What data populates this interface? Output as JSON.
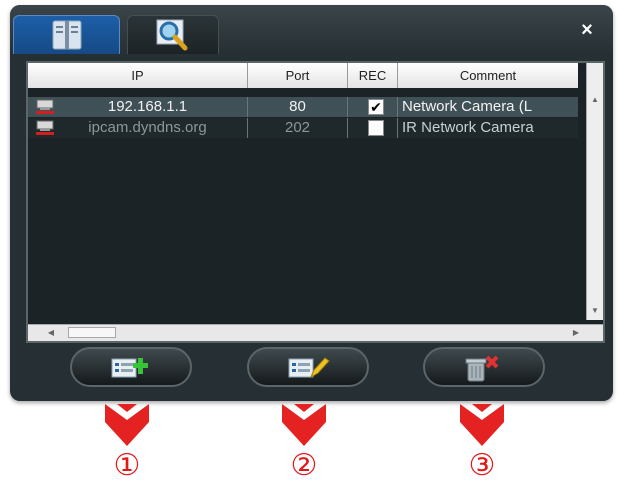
{
  "dialog": {
    "close_label": "×"
  },
  "columns": [
    "IP",
    "Port",
    "REC",
    "Comment"
  ],
  "rows": [
    {
      "ip": "192.168.1.1",
      "port": "80",
      "rec": true,
      "rec_mark": "✔",
      "comment": "Network Camera (L"
    },
    {
      "ip": "ipcam.dyndns.org",
      "port": "202",
      "rec": false,
      "rec_mark": "",
      "comment": "IR Network Camera"
    }
  ],
  "scroll": {
    "up": "▲",
    "down": "▼",
    "left": "◀",
    "right": "▶"
  },
  "buttons": {
    "add_icon": "add-device-icon",
    "edit_icon": "edit-device-icon",
    "delete_icon": "delete-device-icon"
  },
  "callouts": [
    "①",
    "②",
    "③"
  ],
  "colors": {
    "window_bg": "#262f33",
    "selected_row": "#3f5156",
    "callout_red": "#e01a1a",
    "add_green": "#37c437",
    "delete_red": "#e03232"
  }
}
